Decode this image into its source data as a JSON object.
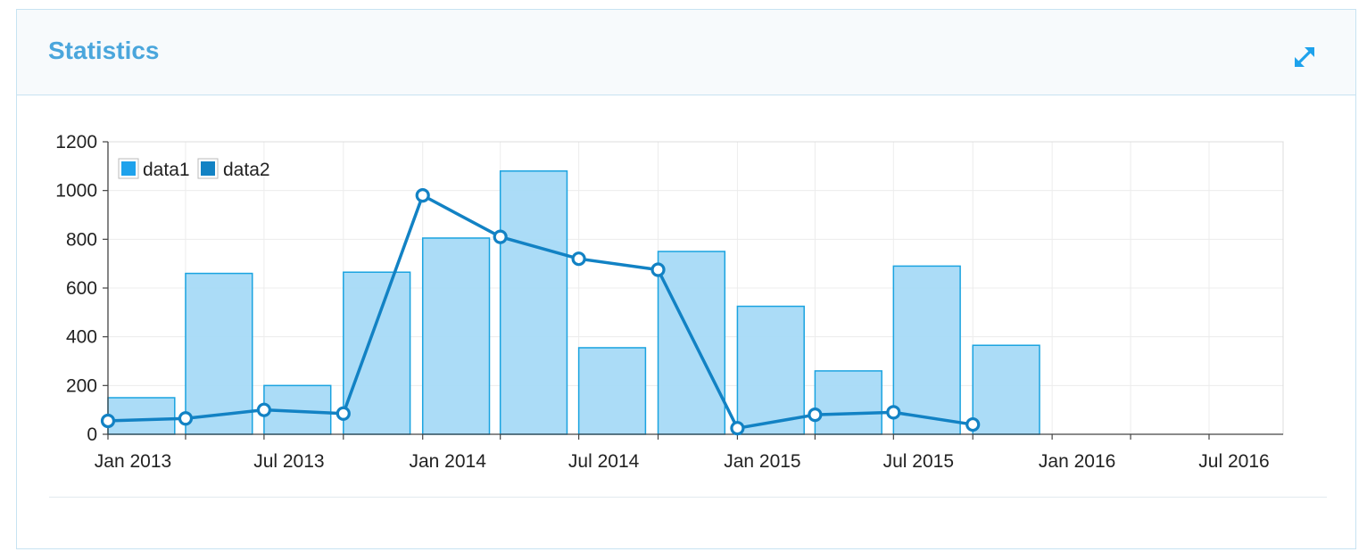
{
  "widget": {
    "title": "Statistics",
    "expand_icon": "expand-arrows-icon"
  },
  "colors": {
    "title": "#4aa6dc",
    "bar_fill": "#a6daf7",
    "bar_stroke": "#1aa3e0",
    "line": "#1282c4",
    "legend_data1": "#1ea2ec",
    "legend_data2": "#1282c4"
  },
  "chart_data": {
    "type": "bar+line",
    "x_dates": [
      "2013-01-01",
      "2013-04-01",
      "2013-07-01",
      "2013-10-01",
      "2014-01-01",
      "2014-04-01",
      "2014-07-01",
      "2014-10-01",
      "2015-01-01",
      "2015-04-01",
      "2015-07-01",
      "2015-10-01",
      "2016-01-01",
      "2016-04-01",
      "2016-07-01"
    ],
    "series": [
      {
        "name": "data1",
        "type": "bar",
        "values": [
          150,
          660,
          200,
          665,
          805,
          1080,
          355,
          750,
          525,
          260,
          690,
          365
        ]
      },
      {
        "name": "data2",
        "type": "line",
        "values": [
          55,
          65,
          100,
          85,
          980,
          810,
          720,
          675,
          25,
          80,
          90,
          40
        ]
      }
    ],
    "ylim": [
      0,
      1200
    ],
    "y_ticks": [
      "0",
      "200",
      "400",
      "600",
      "800",
      "1000",
      "1200"
    ],
    "x_ticks": [
      "Jan 2013",
      "Jul 2013",
      "Jan 2014",
      "Jul 2014",
      "Jan 2015",
      "Jul 2015",
      "Jan 2016",
      "Jul 2016"
    ],
    "legend": [
      "data1",
      "data2"
    ],
    "legend_position": "top-left",
    "grid": true
  }
}
